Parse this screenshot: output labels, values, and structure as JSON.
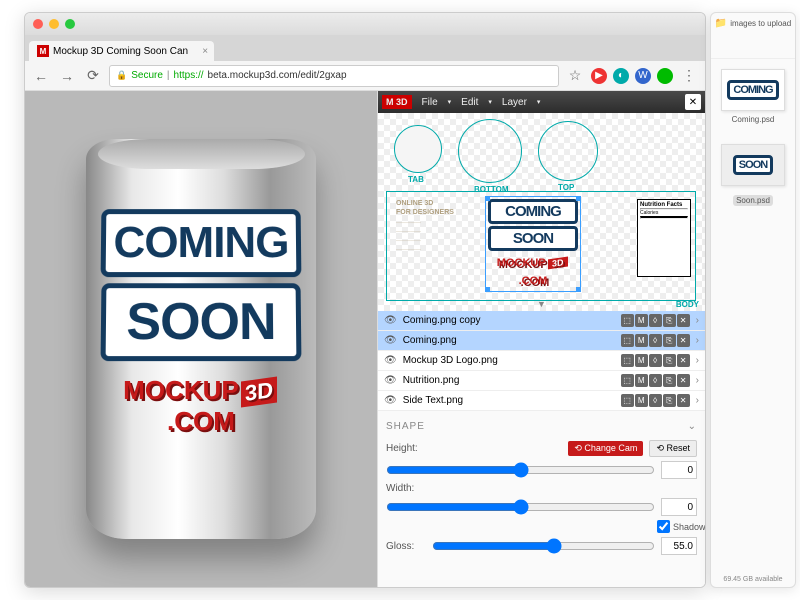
{
  "browser": {
    "tab_title": "Mockup 3D Coming Soon Can",
    "secure_label": "Secure",
    "url_prefix": "https://",
    "url": "beta.mockup3d.com/edit/2gxap"
  },
  "menus": [
    "File",
    "Edit",
    "Layer"
  ],
  "app_badge": "M 3D",
  "uv_labels": {
    "tab": "TAB",
    "bottom": "BOTTOM",
    "top": "TOP",
    "body": "BODY"
  },
  "side_text": [
    "ONLINE 3D",
    "FOR DESIGNERS"
  ],
  "nutrition_title": "Nutrition Facts",
  "label_coming": "COMING",
  "label_soon": "SOON",
  "logo_text_a": "MOCKUP",
  "logo_text_b": "3D",
  "logo_text_c": ".COM",
  "layers": [
    {
      "name": "Coming.png copy",
      "selected": true
    },
    {
      "name": "Coming.png",
      "selected": true
    },
    {
      "name": "Mockup 3D Logo.png",
      "selected": false
    },
    {
      "name": "Nutrition.png",
      "selected": false
    },
    {
      "name": "Side Text.png",
      "selected": false
    }
  ],
  "shape": {
    "title": "SHAPE",
    "height_label": "Height:",
    "width_label": "Width:",
    "gloss_label": "Gloss:",
    "shadow_label": "Shadow",
    "change_cam": "⟲ Change Cam",
    "reset": "⟲ Reset",
    "height_val": "0",
    "width_val": "0",
    "gloss_val": "55.0"
  },
  "finder": {
    "folder": "images to upload",
    "files": [
      {
        "name": "Coming.psd",
        "label": "COMING"
      },
      {
        "name": "Soon.psd",
        "label": "SOON"
      }
    ],
    "status": "69.45 GB available"
  }
}
